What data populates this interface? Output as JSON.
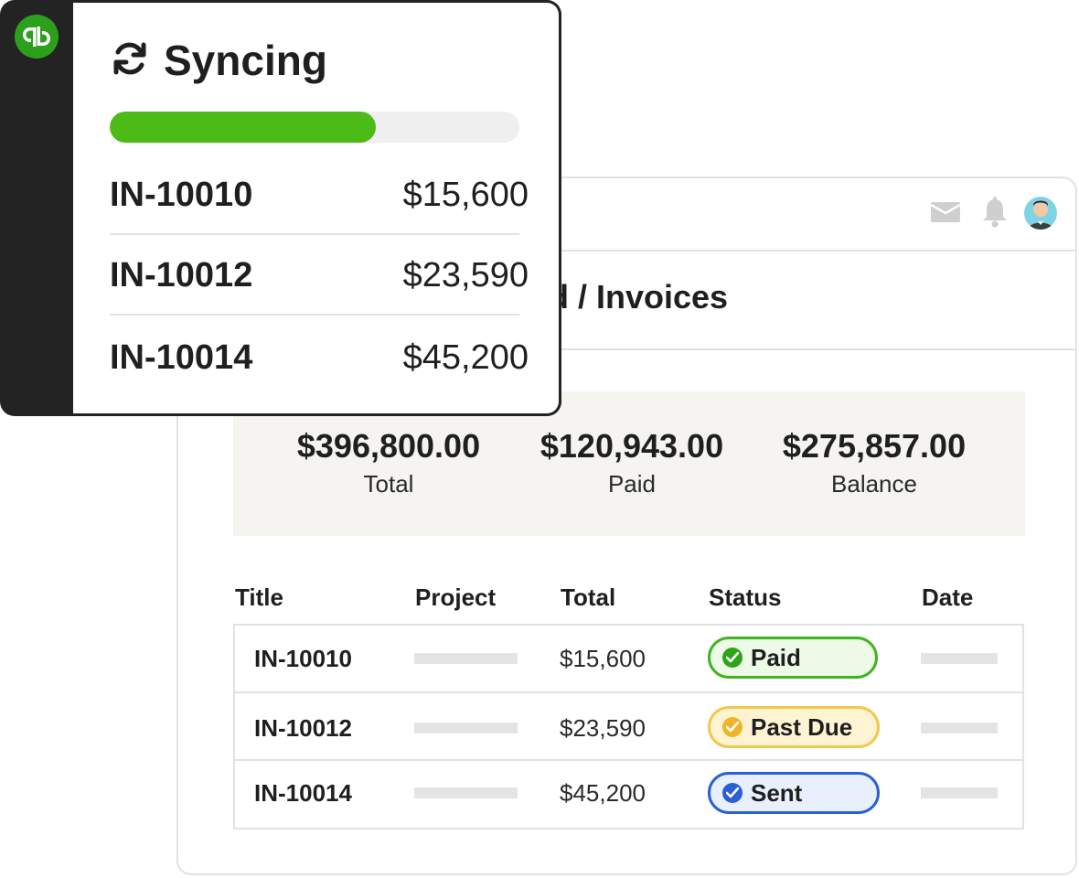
{
  "app": {
    "page_title": "d / Invoices",
    "summary": [
      {
        "value": "$396,800.00",
        "label": "Total"
      },
      {
        "value": "$120,943.00",
        "label": "Paid"
      },
      {
        "value": "$275,857.00",
        "label": "Balance"
      }
    ],
    "columns": [
      "Title",
      "Project",
      "Total",
      "Status",
      "Date"
    ],
    "rows": [
      {
        "title": "IN-10010",
        "total": "$15,600",
        "status": "Paid"
      },
      {
        "title": "IN-10012",
        "total": "$23,590",
        "status": "Past Due"
      },
      {
        "title": "IN-10014",
        "total": "$45,200",
        "status": "Sent"
      }
    ],
    "icons": [
      "mail-icon",
      "bell-icon",
      "avatar"
    ]
  },
  "sync": {
    "title": "Syncing",
    "progress": 0.65,
    "items": [
      {
        "id": "IN-10010",
        "amount": "$15,600"
      },
      {
        "id": "IN-10012",
        "amount": "$23,590"
      },
      {
        "id": "IN-10014",
        "amount": "$45,200"
      }
    ],
    "logo_icon": "quickbooks-logo-icon",
    "sync_icon": "refresh-icon"
  },
  "colors": {
    "paid_border": "#3db61e",
    "paid_fill": "#eefae8",
    "paid_dot": "#2ea318",
    "pastdue_border": "#f2c84b",
    "pastdue_fill": "#fff4d2",
    "pastdue_dot": "#f0b527",
    "sent_border": "#2b5fd6",
    "sent_fill": "#e9f0fd",
    "sent_dot": "#2b5fd6",
    "progress": "#4cba17",
    "brand": "#2ca01c"
  }
}
